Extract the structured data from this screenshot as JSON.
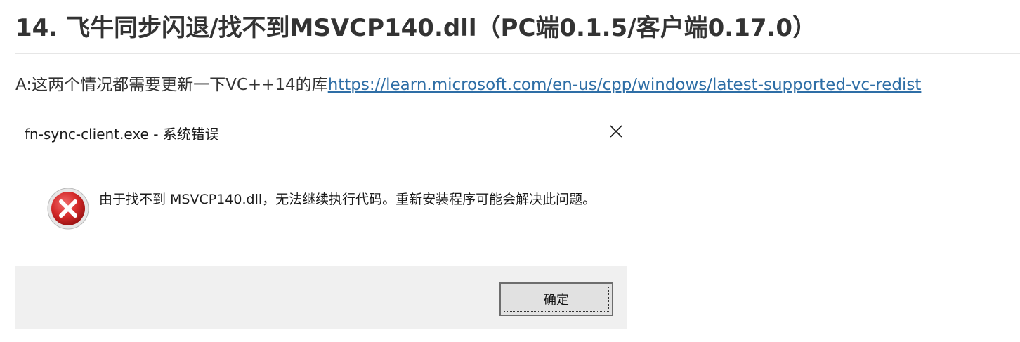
{
  "heading": "14. 飞牛同步闪退/找不到MSVCP140.dll（PC端0.1.5/客户端0.17.0）",
  "answer": {
    "prefix": "A:这两个情况都需要更新一下VC++14的库",
    "link_text": "https://learn.microsoft.com/en-us/cpp/windows/latest-supported-vc-redist"
  },
  "dialog": {
    "title": "fn-sync-client.exe - 系统错误",
    "message": "由于找不到 MSVCP140.dll，无法继续执行代码。重新安装程序可能会解决此问题。",
    "ok_label": "确定",
    "icons": {
      "close": "close-icon",
      "error": "error-icon"
    }
  },
  "colors": {
    "link": "#2e6ea6",
    "error_red": "#d42a2a",
    "footer_bg": "#f0f0f0"
  }
}
